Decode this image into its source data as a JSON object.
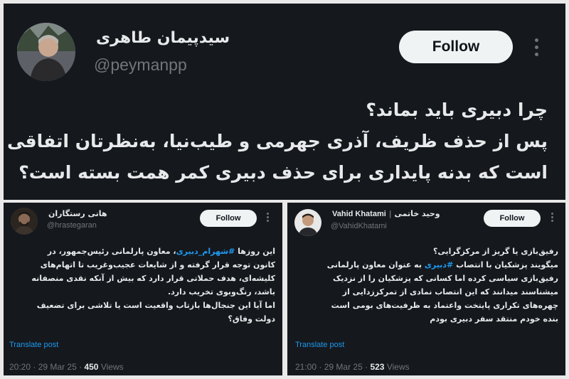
{
  "top_tweet": {
    "display_name": "سیدپیمان طاهری",
    "handle": "@peymanpp",
    "follow_label": "Follow",
    "lines": [
      "چرا دبیری باید بماند؟",
      "پس از حذف ظریف، آذری جهرمی و طیب‌نیا، به‌نظرتان اتفاقی",
      "است که بدنه پایداری برای حذف دبیری کمر همت بسته است؟"
    ]
  },
  "left_tweet": {
    "display_name": "هانی رستگاران",
    "handle": "@hrastegaran",
    "follow_label": "Follow",
    "line1_before": "این روزها ",
    "line1_hashtag": "#شهرام_دبیری",
    "line1_after": "، معاون پارلمانی رئیس‌جمهور، در",
    "lines": [
      "کانون توجه قرار گرفته و از شایعات عجیب‌وغریب تا اتهام‌های",
      "کلیشه‌ای، هدف حملاتی قرار دارد که بیش از آنکه نقدی منصفانه",
      "باشد، رنگ‌وبوی تخریب دارد.",
      "اما آیا این جنجال‌ها بازتاب واقعیت است یا تلاشی برای تضعیف",
      "دولت وفاق؟"
    ],
    "translate_label": "Translate post",
    "time": "20:20",
    "date": "29 Mar 25",
    "views": "450",
    "views_label": "Views"
  },
  "right_tweet": {
    "display_name_en": "Vahid Khatami",
    "display_name_fa": "وحید خاتمی",
    "handle": "@VahidKhatami",
    "follow_label": "Follow",
    "line1": "رفیق‌بازی یا گریز از مرکزگرایی؟",
    "line2_before": "میگویند پزشکیان با انتصاب ",
    "line2_hashtag": "#دبیری",
    "line2_after": " به عنوان معاون پارلمانی",
    "lines": [
      "رفیق‌بازی سیاسی کرده اما کسانی که پزشکیان را از نزدیک",
      "میشناسند میدانند که این انتصاب نمادی از تمرکززدایی از",
      "چهره‌های تکراری پایتخت واعتماد به ظرفیت‌های بومی است",
      "بنده خودم منتقد سفر دبیری بودم"
    ],
    "translate_label": "Translate post",
    "time": "21:00",
    "date": "29 Mar 25",
    "views": "523",
    "views_label": "Views"
  },
  "colors": {
    "background": "#15181d",
    "divider": "#e9e9e9",
    "text": "#e7e9ea",
    "muted": "#71767b",
    "link": "#1d9bf0",
    "button": "#eff3f4"
  }
}
